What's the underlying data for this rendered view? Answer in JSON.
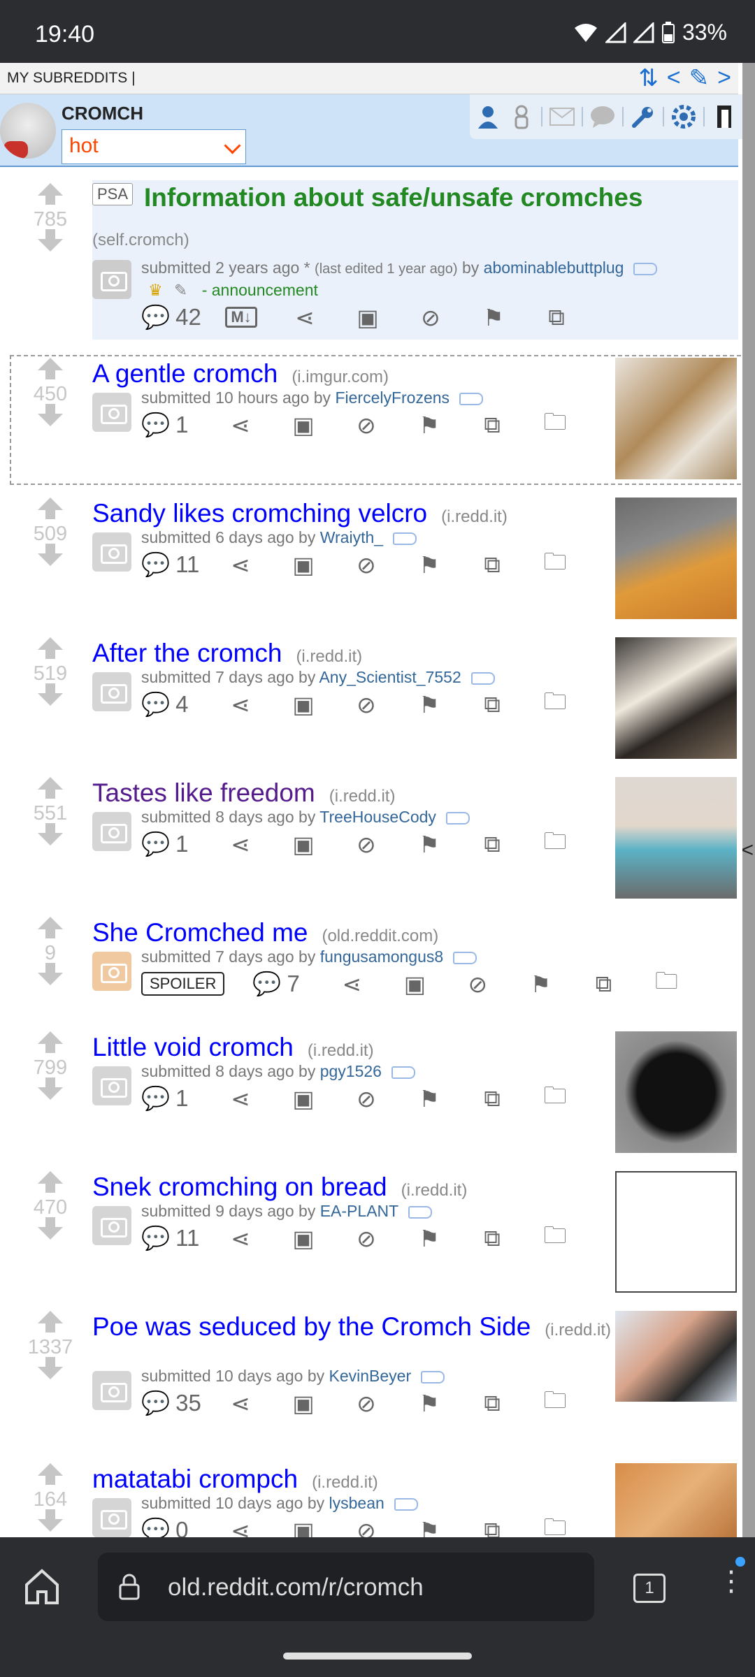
{
  "status": {
    "time": "19:40",
    "battery": "33%"
  },
  "subbar": {
    "label": "MY SUBREDDITS  |"
  },
  "header": {
    "subreddit": "CROMCH",
    "sort": "hot"
  },
  "psa": {
    "tag": "PSA",
    "title": "Information about safe/unsafe cromches",
    "domain": "(self.cromch)",
    "score": "785",
    "meta_prefix": "submitted 2 years ago * ",
    "meta_edited": "(last edited 1 year ago)",
    "meta_by": " by ",
    "author": "abominablebuttplug",
    "flair": "- announcement",
    "comments": "42"
  },
  "posts": [
    {
      "score": "450",
      "title": "A gentle cromch",
      "domain": "(i.imgur.com)",
      "meta_prefix": "submitted 10 hours ago by ",
      "author": "FiercelyFrozens",
      "comments": "1"
    },
    {
      "score": "509",
      "title": "Sandy likes cromching velcro",
      "domain": "(i.redd.it)",
      "meta_prefix": "submitted 6 days ago by ",
      "author": "Wraiyth_",
      "comments": "11"
    },
    {
      "score": "519",
      "title": "After the cromch",
      "domain": "(i.redd.it)",
      "meta_prefix": "submitted 7 days ago by ",
      "author": "Any_Scientist_7552",
      "comments": "4"
    },
    {
      "score": "551",
      "title": "Tastes like freedom",
      "domain": "(i.redd.it)",
      "meta_prefix": "submitted 8 days ago by ",
      "author": "TreeHouseCody",
      "comments": "1",
      "visited": true
    },
    {
      "score": "9",
      "title": "She Cromched me",
      "domain": "(old.reddit.com)",
      "meta_prefix": "submitted 7 days ago by ",
      "author": "fungusamongus8",
      "comments": "7",
      "spoiler": "SPOILER"
    },
    {
      "score": "799",
      "title": "Little void cromch",
      "domain": "(i.redd.it)",
      "meta_prefix": "submitted 8 days ago by ",
      "author": "pgy1526",
      "comments": "1"
    },
    {
      "score": "470",
      "title": "Snek cromching on bread",
      "domain": "(i.redd.it)",
      "meta_prefix": "submitted 9 days ago by ",
      "author": "EA-PLANT",
      "comments": "11"
    },
    {
      "score": "1337",
      "title": "Poe was seduced by the Cromch Side",
      "domain": "(i.redd.it)",
      "meta_prefix": "submitted 10 days ago by ",
      "author": "KevinBeyer",
      "comments": "35"
    },
    {
      "score": "164",
      "title": "matatabi crompch",
      "domain": "(i.redd.it)",
      "meta_prefix": "submitted 10 days ago by ",
      "author": "lysbean",
      "comments": "0"
    }
  ],
  "browser": {
    "url": "old.reddit.com/r/cromch",
    "tabs": "1"
  },
  "colors": {
    "link": "#0000ff",
    "visited": "#551a8b",
    "psa": "#228822",
    "header": "#cee3f8"
  }
}
